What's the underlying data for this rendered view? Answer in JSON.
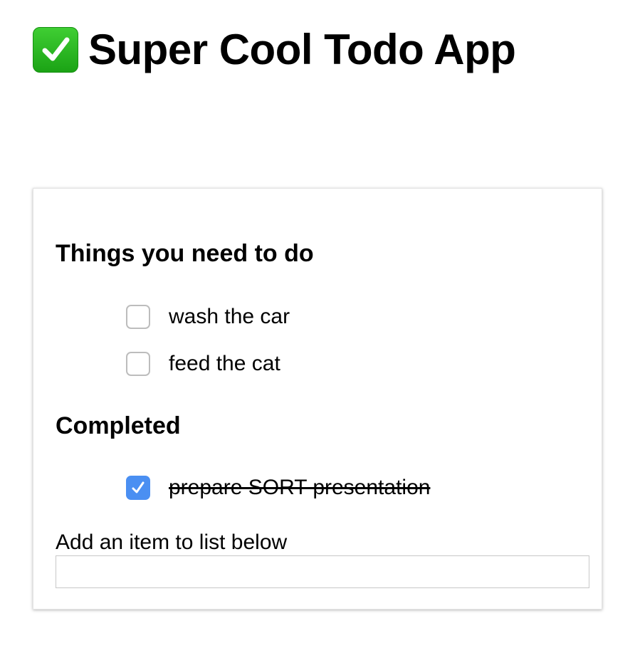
{
  "header": {
    "icon": "check-mark-button-icon",
    "title": "Super Cool Todo App",
    "icon_color": "#2db523"
  },
  "todo_section": {
    "heading": "Things you need to do",
    "items": [
      {
        "label": "wash the car",
        "checked": false
      },
      {
        "label": "feed the cat",
        "checked": false
      }
    ]
  },
  "completed_section": {
    "heading": "Completed",
    "items": [
      {
        "label": "prepare SORT presentation",
        "checked": true
      }
    ]
  },
  "add_item": {
    "label": "Add an item to list below",
    "value": "",
    "placeholder": ""
  },
  "colors": {
    "checkbox_checked": "#4a8ff2",
    "checkbox_border": "#bdbdbd"
  }
}
